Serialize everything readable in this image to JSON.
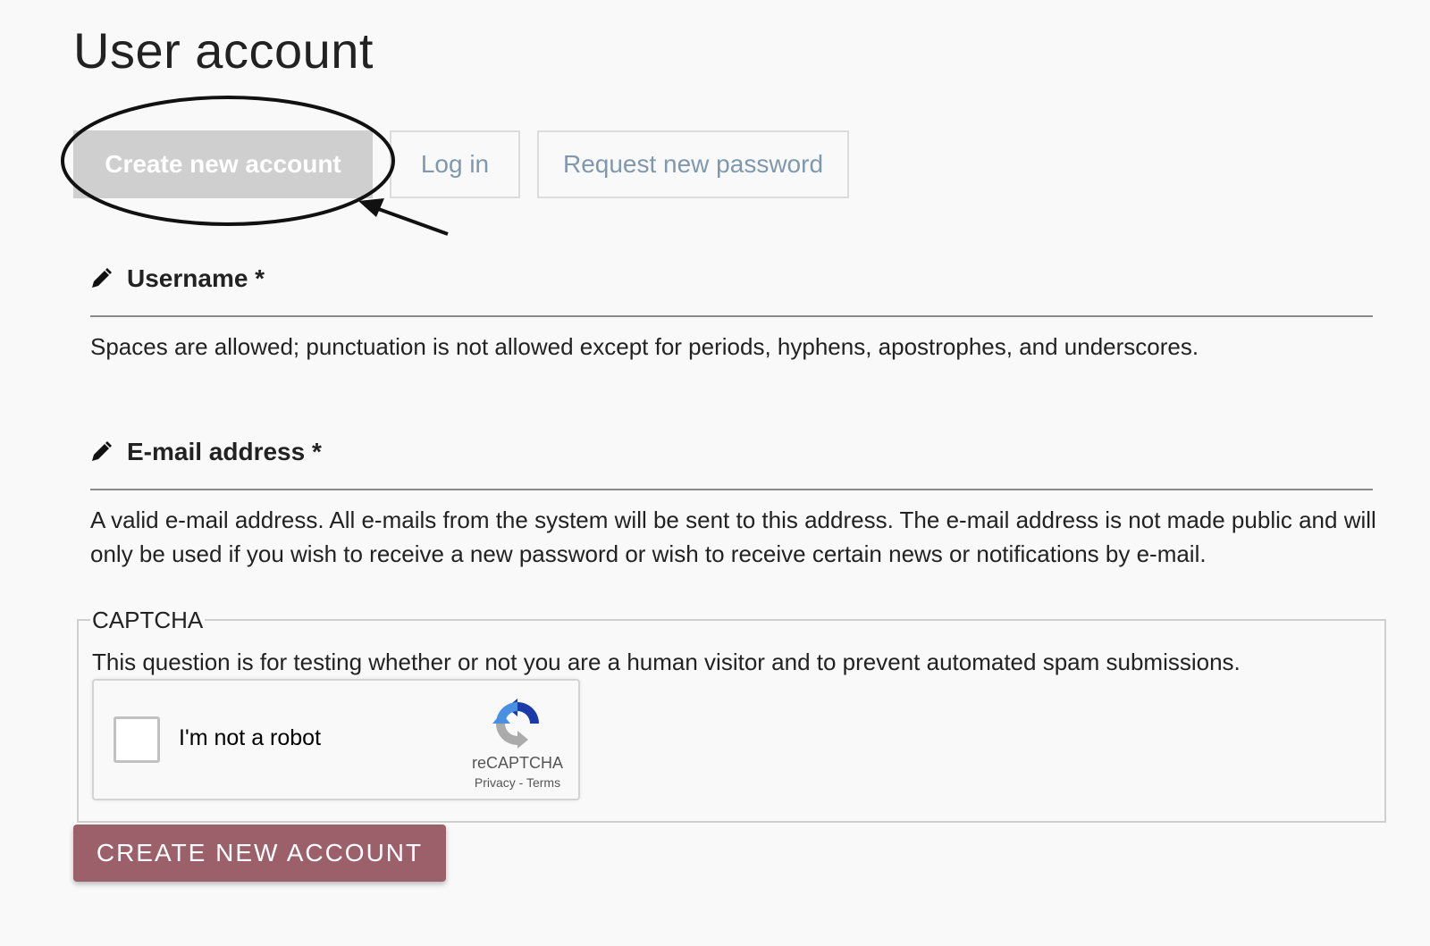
{
  "page": {
    "title": "User account"
  },
  "tabs": [
    {
      "label": "Create new account",
      "active": true
    },
    {
      "label": "Log in",
      "active": false
    },
    {
      "label": "Request new password",
      "active": false
    }
  ],
  "form": {
    "username": {
      "icon": "pencil-icon",
      "label": "Username *",
      "description": "Spaces are allowed; punctuation is not allowed except for periods, hyphens, apostrophes, and underscores."
    },
    "email": {
      "icon": "pencil-icon",
      "label": "E-mail address *",
      "description": "A valid e-mail address. All e-mails from the system will be sent to this address. The e-mail address is not made public and will only be used if you wish to receive a new password or wish to receive certain news or notifications by e-mail."
    },
    "captcha": {
      "legend": "CAPTCHA",
      "help": "This question is for testing whether or not you are a human visitor and to prevent automated spam submissions.",
      "recaptcha": {
        "checkbox_label": "I'm not a robot",
        "brand": "reCAPTCHA",
        "privacy_link": "Privacy",
        "separator": " - ",
        "terms_link": "Terms"
      }
    },
    "submit_label": "CREATE NEW ACCOUNT"
  },
  "colors": {
    "background": "#f9f9f9",
    "active_tab_bg": "#cfcfcf",
    "inactive_tab_text": "#7f98ad",
    "submit_bg": "#9c606b",
    "recaptcha_blue": "#1c3aa9",
    "recaptcha_lightblue": "#4a90e2",
    "recaptcha_gray": "#ababab"
  }
}
